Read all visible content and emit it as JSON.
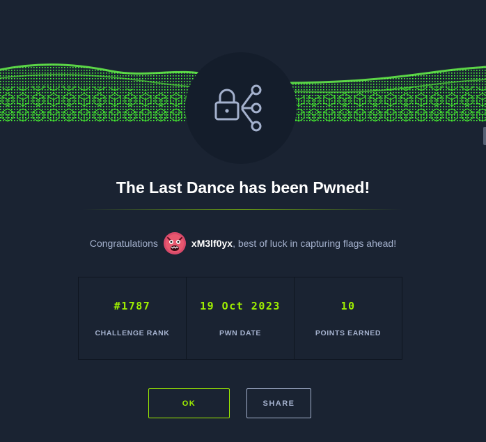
{
  "modal": {
    "title": "The Last Dance has been Pwned!",
    "congrats_prefix": "Congratulations",
    "username": "xM3lf0yx",
    "congrats_suffix": ", best of luck in capturing flags ahead!"
  },
  "stats": [
    {
      "value": "#1787",
      "label": "CHALLENGE RANK"
    },
    {
      "value": "19 Oct 2023",
      "label": "PWN DATE"
    },
    {
      "value": "10",
      "label": "POINTS EARNED"
    }
  ],
  "buttons": {
    "ok_label": "OK",
    "share_label": "SHARE"
  },
  "icons": {
    "center": "lock-share-icon",
    "avatar": "user-avatar"
  },
  "colors": {
    "background": "#1a2332",
    "accent": "#9fef00",
    "muted": "#a4b1cd",
    "title": "#ffffff"
  }
}
